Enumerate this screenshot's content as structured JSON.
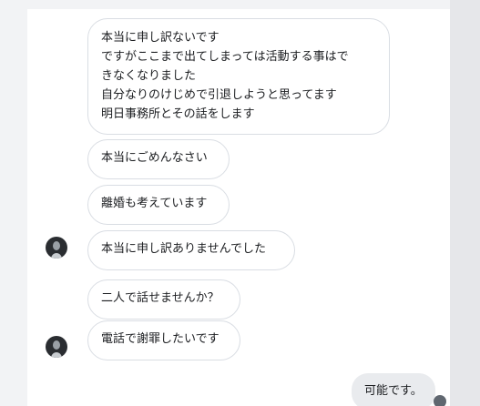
{
  "conversation": {
    "messages": [
      {
        "lines": [
          "本当に申し訳ないです",
          "ですがここまで出てしまっては活動する事はで",
          "きなくなりました",
          "自分なりのけじめで引退しようと思ってます",
          "明日事務所とその話をします"
        ]
      },
      {
        "lines": [
          "本当にごめんなさい"
        ]
      },
      {
        "lines": [
          "離婚も考えています"
        ]
      },
      {
        "lines": [
          "本当に申し訳ありませんでした"
        ]
      },
      {
        "lines": [
          "二人で話せませんか？"
        ]
      },
      {
        "lines": [
          "電話で謝罪したいです"
        ]
      }
    ],
    "reply": "可能です。"
  },
  "colors": {
    "bubble_border": "#d9dde3",
    "outgoing_bg": "#e9ebee",
    "background": "#f2f3f5"
  }
}
